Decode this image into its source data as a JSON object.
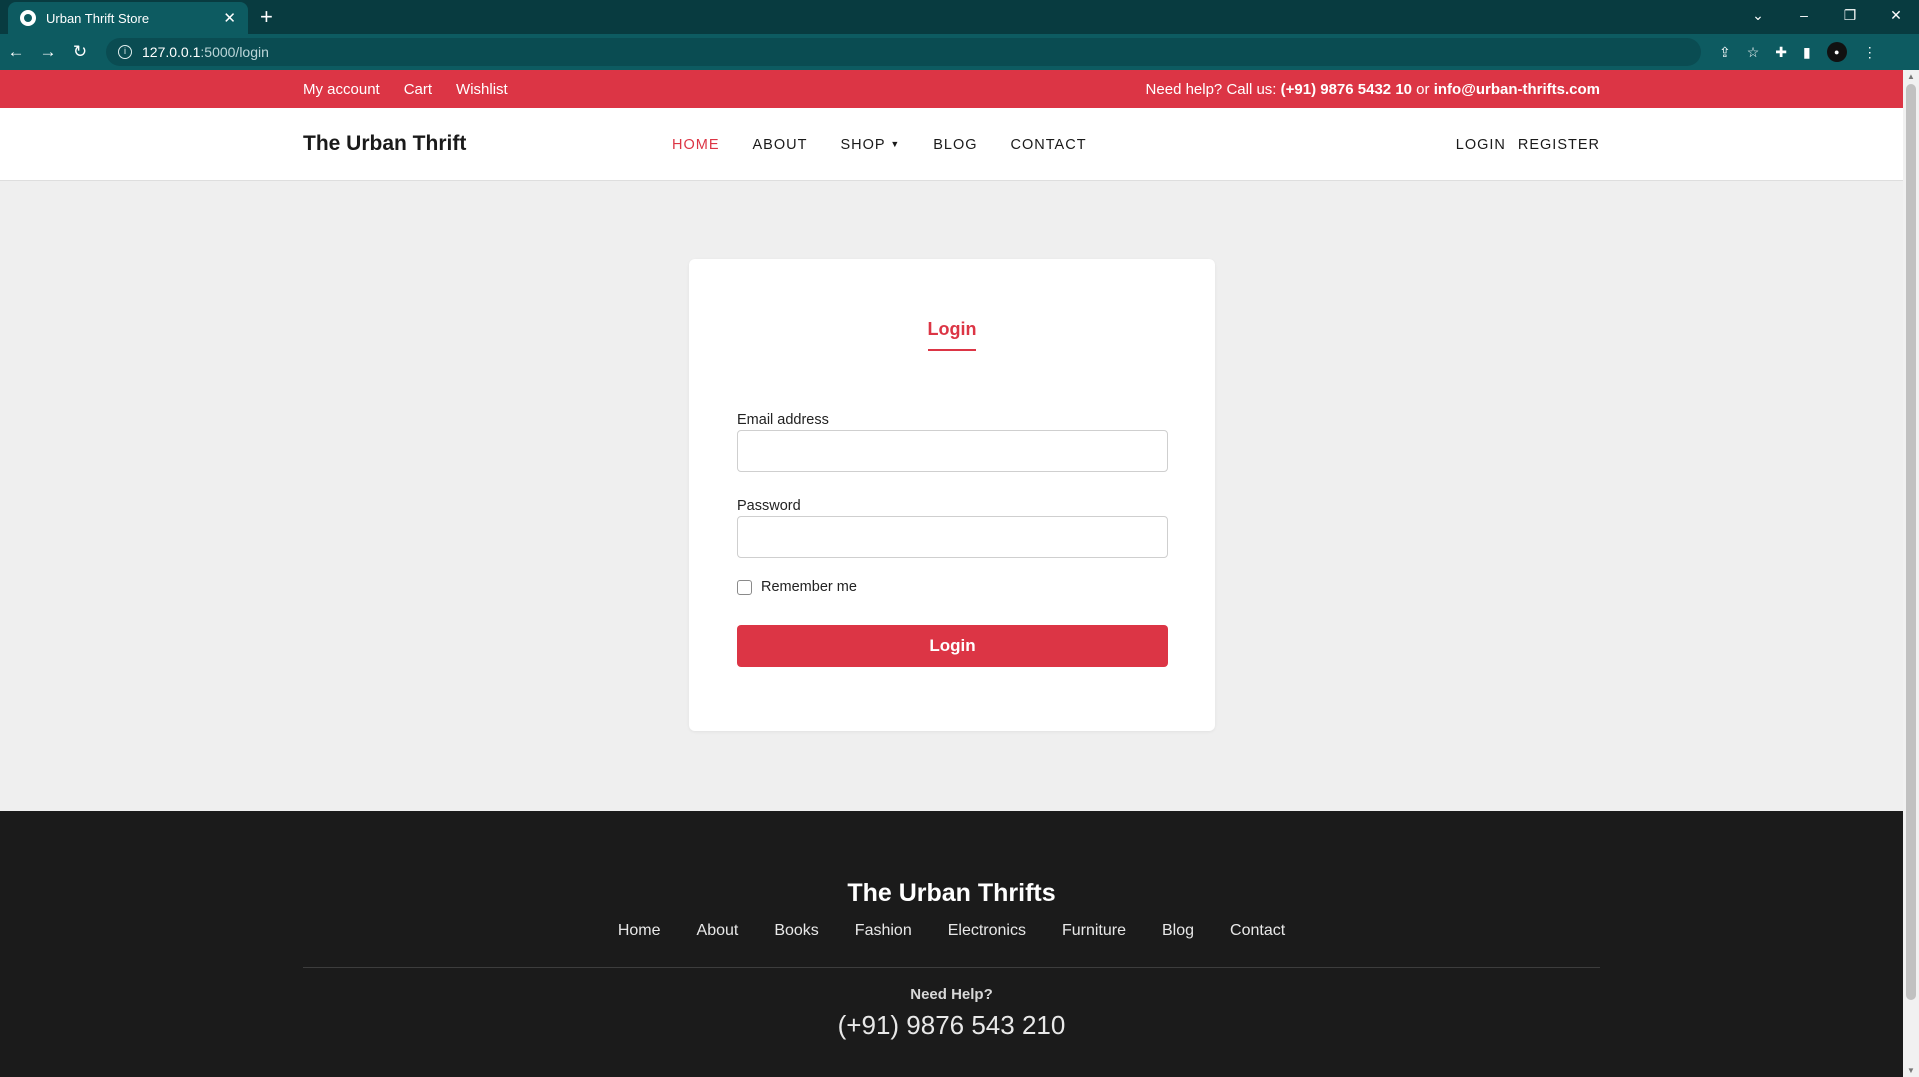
{
  "browser": {
    "tab_title": "Urban Thrift Store",
    "tab_close": "✕",
    "new_tab": "+",
    "url_host": "127.0.0.1",
    "url_path": ":5000/login",
    "nav": {
      "back": "←",
      "forward": "→",
      "reload": "↻"
    }
  },
  "topbar": {
    "links": [
      "My account",
      "Cart",
      "Wishlist"
    ],
    "help_prefix": "Need help? Call us: ",
    "help_phone": "(+91) 9876 5432 10",
    "help_or": " or ",
    "help_email": "info@urban-thrifts.com"
  },
  "navbar": {
    "brand": "The Urban Thrift",
    "menu": [
      "HOME",
      "ABOUT",
      "SHOP",
      "BLOG",
      "CONTACT"
    ],
    "login": "LOGIN",
    "register": "REGISTER"
  },
  "login_form": {
    "title": "Login",
    "email_label": "Email address",
    "email_value": "",
    "password_label": "Password",
    "password_value": "",
    "remember_label": "Remember me",
    "submit_label": "Login"
  },
  "footer": {
    "brand": "The Urban Thrifts",
    "links": [
      "Home",
      "About",
      "Books",
      "Fashion",
      "Electronics",
      "Furniture",
      "Blog",
      "Contact"
    ],
    "help_title": "Need Help?",
    "phone": "(+91) 9876 543 210"
  },
  "colors": {
    "accent": "#dc3545",
    "browser_bg": "#0d5b61",
    "footer_bg": "#1b1b1b",
    "page_bg": "#efefef"
  }
}
